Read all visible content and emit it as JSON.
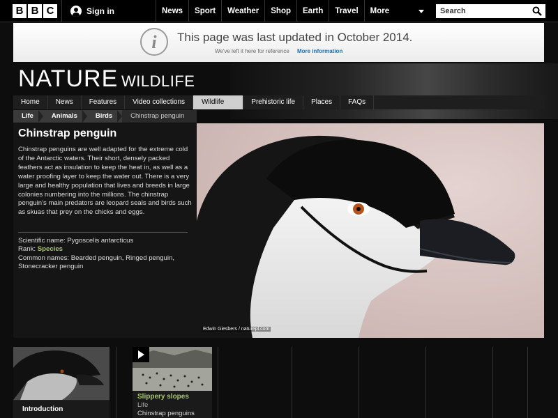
{
  "topbar": {
    "logo_letters": [
      "B",
      "B",
      "C"
    ],
    "signin": "Sign in",
    "nav": [
      "News",
      "Sport",
      "Weather",
      "Shop",
      "Earth",
      "Travel",
      "More"
    ],
    "search_placeholder": "Search"
  },
  "notice": {
    "title": "This page was last updated in October 2014.",
    "subtitle": "We've left it here for reference",
    "link": "More information"
  },
  "masthead": {
    "title": "NATURE",
    "subtitle": "WILDLIFE"
  },
  "section_nav": {
    "items": [
      "Home",
      "News",
      "Features",
      "Video collections",
      "Wildlife",
      "Prehistoric life",
      "Places",
      "FAQs"
    ],
    "active": "Wildlife"
  },
  "breadcrumb": {
    "items": [
      "Life",
      "Animals",
      "Birds"
    ],
    "current": "Chinstrap penguin"
  },
  "species": {
    "name": "Chinstrap penguin",
    "description": "Chinstrap penguins are well adapted for the extreme cold of the Antarctic waters. Their short, densely packed feathers act as insulation to keep the heat in, as well as a water proofing layer to keep the water out. There is a very large and healthy population that lives and breeds in large colonies numbering into the millions. The chinstrap penguin's main predators are leopard seals and birds such as skuas that prey on the chicks and eggs.",
    "scientific_label": "Scientific name: ",
    "scientific_name": "Pygoscelis antarcticus",
    "rank_label": "Rank: ",
    "rank": "Species",
    "common_label": "Common names: ",
    "common_names": "Bearded penguin, Ringed penguin, Stonecracker penguin"
  },
  "hero": {
    "credit": "Edwin Giesbers / naturepl.com"
  },
  "modules": {
    "intro_label": "Introduction",
    "video_title": "Slippery slopes",
    "video_category": "Life",
    "video_subject": "Chinstrap penguins"
  },
  "colors": {
    "accent_green": "#a8c66c",
    "link_blue": "#1a6fb5",
    "background": "#0d0d0d"
  }
}
